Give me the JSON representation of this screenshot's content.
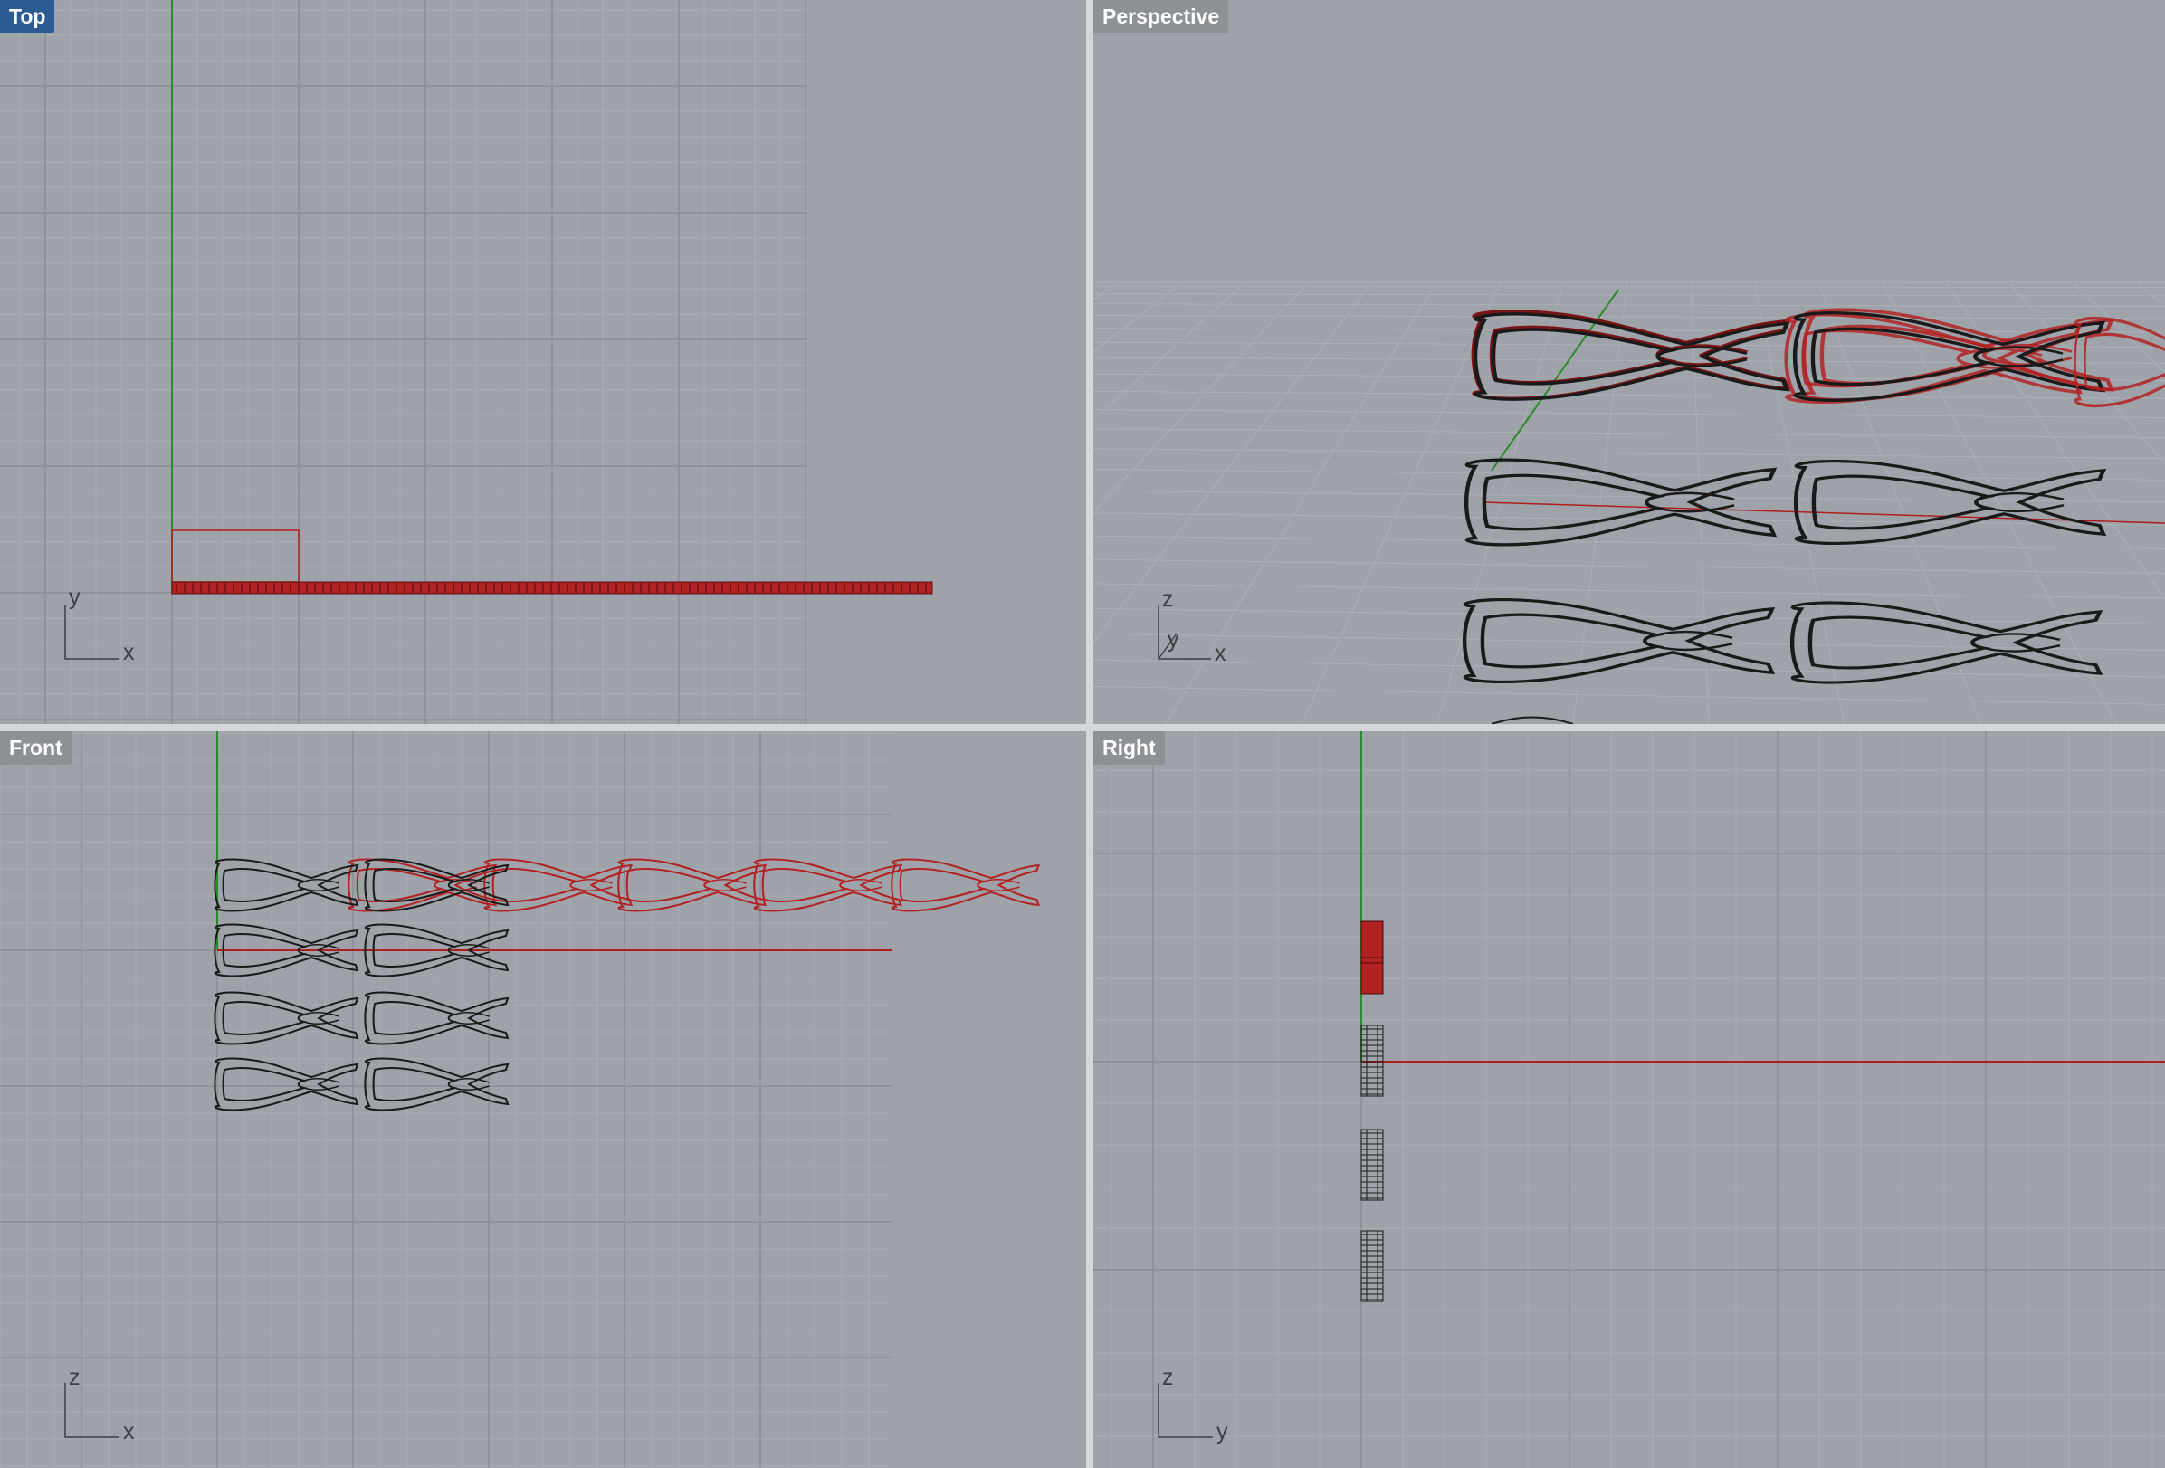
{
  "viewports": {
    "top": {
      "label": "Top",
      "active": true,
      "axis_labels": {
        "vertical": "y",
        "horizontal": "x"
      }
    },
    "perspective": {
      "label": "Perspective",
      "active": false,
      "axis_labels": {
        "vertical": "z",
        "depth": "y",
        "horizontal": "x"
      }
    },
    "front": {
      "label": "Front",
      "active": false,
      "axis_labels": {
        "vertical": "z",
        "horizontal": "x"
      }
    },
    "right": {
      "label": "Right",
      "active": false,
      "axis_labels": {
        "vertical": "z",
        "horizontal": "y"
      }
    }
  },
  "colors": {
    "viewport_bg": "#9ea3a9",
    "grid_minor": "#a8adb3",
    "grid_major": "#8b9096",
    "x_axis": "#b11e1e",
    "y_axis": "#2c8a2c",
    "selected": "#b32222",
    "curve": "#1a1a1a",
    "active_label_bg": "#2c5a93"
  },
  "icons": {
    "axis_gizmo": "axis-gizmo-icon"
  }
}
